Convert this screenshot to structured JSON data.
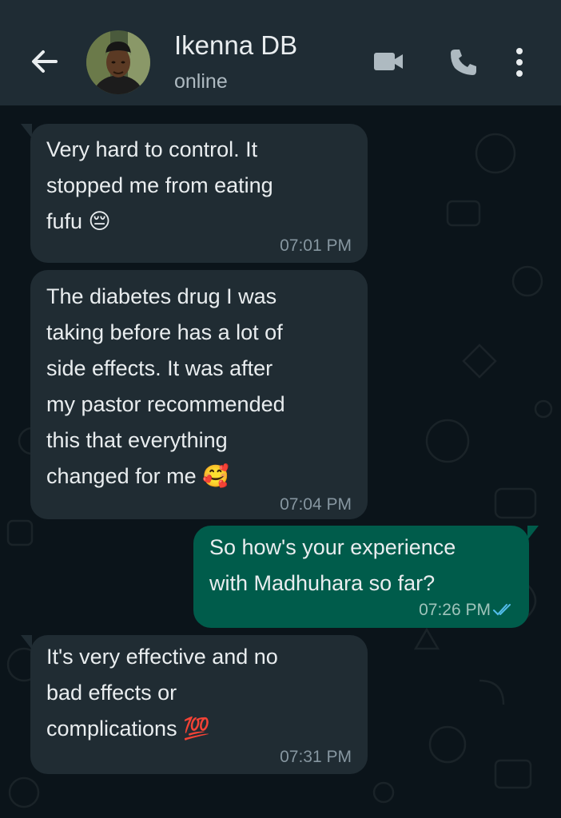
{
  "header": {
    "contact_name": "Ikenna DB",
    "contact_status": "online",
    "icons": {
      "back": "arrow-back-icon",
      "video": "video-call-icon",
      "call": "phone-icon",
      "menu": "more-vertical-icon"
    }
  },
  "messages": [
    {
      "direction": "incoming",
      "text": "Very hard to control. It\nstopped me from eating\nfufu 😔",
      "time": "07:01 PM"
    },
    {
      "direction": "incoming",
      "text": "The diabetes drug I was\ntaking before has a lot of\nside effects. It was after\nmy pastor recommended\nthis that everything\nchanged for me 🥰",
      "time": "07:04 PM"
    },
    {
      "direction": "outgoing",
      "text": "So how's your experience\nwith Madhuhara so far?",
      "time": "07:26 PM",
      "status": "read-double-check"
    },
    {
      "direction": "incoming",
      "text": "It's very effective and no\nbad effects or\ncomplications 💯",
      "time": "07:31 PM"
    }
  ],
  "colors": {
    "header_bg": "#1f2c34",
    "chat_bg": "#0b141a",
    "incoming_bubble": "#202c33",
    "outgoing_bubble": "#005c4b",
    "read_check": "#53bdeb"
  }
}
